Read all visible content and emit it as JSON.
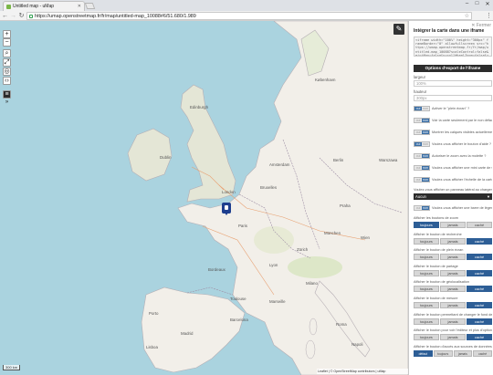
{
  "browser": {
    "tab_title": "Untitled map - uMap",
    "url": "https://umap.openstreetmap.fr/fr/map/untitled-map_10088#6/51.680/1.989",
    "window_controls": {
      "minimize": "–",
      "maximize": "□",
      "close": "✕"
    }
  },
  "map": {
    "controls": {
      "zoom_in": "+",
      "zoom_out": "−",
      "more": "»"
    },
    "icons": [
      "search-icon",
      "fullscreen-icon",
      "locate-icon",
      "embed-icon",
      "layers-icon",
      "pencil-icon",
      "marker-icon"
    ],
    "scale_text": "300 km",
    "attribution": "Leaflet | © OpenStreetMap contributors | uMap",
    "labels": {
      "dublin": "Dublin",
      "london": "London",
      "paris": "Paris",
      "madrid": "Madrid",
      "berlin": "Berlin",
      "wien": "Wien",
      "roma": "Roma",
      "barcelona": "Barcelona",
      "amsterdam": "Amsterdam",
      "bruxelles": "Bruxelles",
      "lyon": "Lyon",
      "bordeaux": "Bordeaux",
      "praha": "Praha",
      "milano": "Milano",
      "edinburgh": "Edinburgh",
      "kobenhavn": "København",
      "toulouse": "Toulouse",
      "marseille": "Marseille",
      "porto": "Porto",
      "lisboa": "Lisboa",
      "zurich": "Zürich",
      "munchen": "München",
      "warszawa": "Warszawa",
      "napoli": "Napoli"
    }
  },
  "panel": {
    "close": "✕ Fermer",
    "title": "Intégrer la carte dans une iframe",
    "embed_code": "<iframe width=\"100%\" height=\"300px\" frameBorder=\"0\" allowfullscreen src=\"https://umap.openstreetmap.fr/fr/map/untitled-map_10088?scaleControl=false&miniMap=false&scrollWheelZoom=false&zoomControl=true&allowEdit=false\"></iframe>",
    "section_title": "Options d'export de l'iframe",
    "width_label": "largeur",
    "width_value": "100%",
    "height_label": "hauteur",
    "height_value": "300px",
    "toggles": [
      {
        "on": "oui",
        "off": "non",
        "label": "Activer le \"plein écran\" ?",
        "active": true
      },
      {
        "on": "oui",
        "off": "non",
        "label": "Voir la carte seulement par le non défaut ?",
        "active": false
      },
      {
        "on": "oui",
        "off": "non",
        "label": "Montrer les calques visibles actuellement",
        "active": false
      },
      {
        "on": "oui",
        "off": "non",
        "label": "Voulez-vous afficher le bouton d'aide ?",
        "active": true
      },
      {
        "on": "oui",
        "off": "non",
        "label": "Autoriser le zoom avec la molette ?",
        "active": false
      },
      {
        "on": "oui",
        "off": "non",
        "label": "Voulez-vous afficher une mini carte de situation ?",
        "active": false
      },
      {
        "on": "oui",
        "off": "non",
        "label": "Voulez-vous afficher l'échelle de la carte ?",
        "active": false
      }
    ],
    "caption_label": "Voulez-vous afficher un panneau latéral au chargement ?",
    "caption_value": "Aucun",
    "last_toggle": {
      "on": "oui",
      "off": "non",
      "label": "Voulez-vous afficher une barre de légende ?",
      "active": false
    },
    "segments": [
      {
        "label": "Afficher les boutons de zoom",
        "options": [
          "toujours",
          "jamais",
          "caché"
        ],
        "selected": 0
      },
      {
        "label": "Afficher le bouton de recherche",
        "options": [
          "toujours",
          "jamais",
          "caché"
        ],
        "selected": 2
      },
      {
        "label": "Afficher le bouton de plein écran",
        "options": [
          "toujours",
          "jamais",
          "caché"
        ],
        "selected": 2
      },
      {
        "label": "Afficher le bouton de partage",
        "options": [
          "toujours",
          "jamais",
          "caché"
        ],
        "selected": 2
      },
      {
        "label": "Afficher le bouton de géolocalisation",
        "options": [
          "toujours",
          "jamais",
          "caché"
        ],
        "selected": 2
      },
      {
        "label": "Afficher le bouton de mesure",
        "options": [
          "toujours",
          "jamais",
          "caché"
        ],
        "selected": 2
      },
      {
        "label": "Afficher le bouton permettant de changer le fond de la carte",
        "options": [
          "toujours",
          "jamais",
          "caché"
        ],
        "selected": 2
      },
      {
        "label": "Afficher le bouton pour voir l'éditeur et plus d'options",
        "options": [
          "toujours",
          "jamais",
          "caché"
        ],
        "selected": 2
      },
      {
        "label": "Afficher le bouton d'accès aux sources de données",
        "options": [
          "défaut",
          "toujours",
          "jamais",
          "caché"
        ],
        "selected": 0
      }
    ]
  }
}
